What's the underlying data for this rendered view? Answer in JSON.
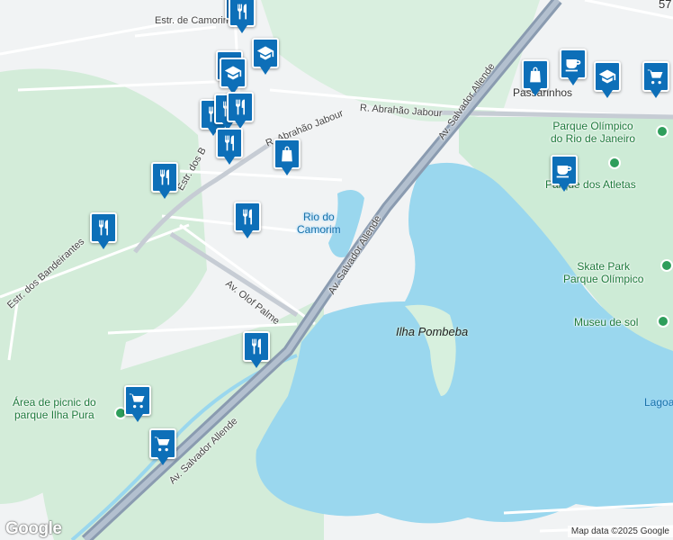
{
  "map": {
    "provider_logo": "Google",
    "attribution": "Map data ©2025 Google",
    "colors": {
      "water": "#9ad7ee",
      "park": "#cdebd6",
      "land": "#f1f3f4",
      "highway": "#8a9bb0",
      "pin": "#0d6fb8",
      "park_pin": "#2e9e5b"
    }
  },
  "labels": {
    "estr_camorim": "Estr. de Camorim",
    "estr_bandeirantes_1": "Estr. dos B",
    "estr_bandeirantes_2": "Estr. dos Bandeirantes",
    "rua_abrahao_1": "R. Abrahão Jabour",
    "rua_abrahao_2": "R. Abrahão Jabour",
    "av_salvador_1": "Av. Salvador Allende",
    "av_salvador_2": "Av. Salvador Allende",
    "av_salvador_3": "Av. Salvador Allende",
    "av_olof": "Av. Olof Palme",
    "rio_camorim": "Rio do\nCamorim",
    "ilha_pombeba": "Ilha Pombeba",
    "area_picnic": "Área de picnic do\nparque Ilha Pura",
    "parque_olimpico": "Parque Olímpico\ndo Rio de Janeiro",
    "parque_atletas": "Parque dos Atletas",
    "skate_park": "Skate Park\nParque Olímpico",
    "museu_sol": "Museu de sol",
    "passarinhos": "Passarinhos",
    "lagoa": "Lagoa",
    "top_right_num": "57"
  },
  "markers": [
    {
      "icon": "school-icon"
    },
    {
      "icon": "restaurant-icon"
    },
    {
      "icon": "school-icon"
    },
    {
      "icon": "school-icon"
    },
    {
      "icon": "school-icon"
    },
    {
      "icon": "restaurant-icon"
    },
    {
      "icon": "restaurant-icon"
    },
    {
      "icon": "restaurant-icon"
    },
    {
      "icon": "shopping-bag-icon"
    },
    {
      "icon": "restaurant-icon"
    },
    {
      "icon": "restaurant-icon"
    },
    {
      "icon": "restaurant-icon"
    },
    {
      "icon": "restaurant-icon"
    },
    {
      "icon": "restaurant-icon"
    },
    {
      "icon": "shopping-bag-icon"
    },
    {
      "icon": "cafe-icon"
    },
    {
      "icon": "school-icon"
    },
    {
      "icon": "shopping-cart-icon"
    },
    {
      "icon": "cafe-icon"
    },
    {
      "icon": "shopping-cart-icon"
    },
    {
      "icon": "shopping-cart-icon"
    }
  ]
}
